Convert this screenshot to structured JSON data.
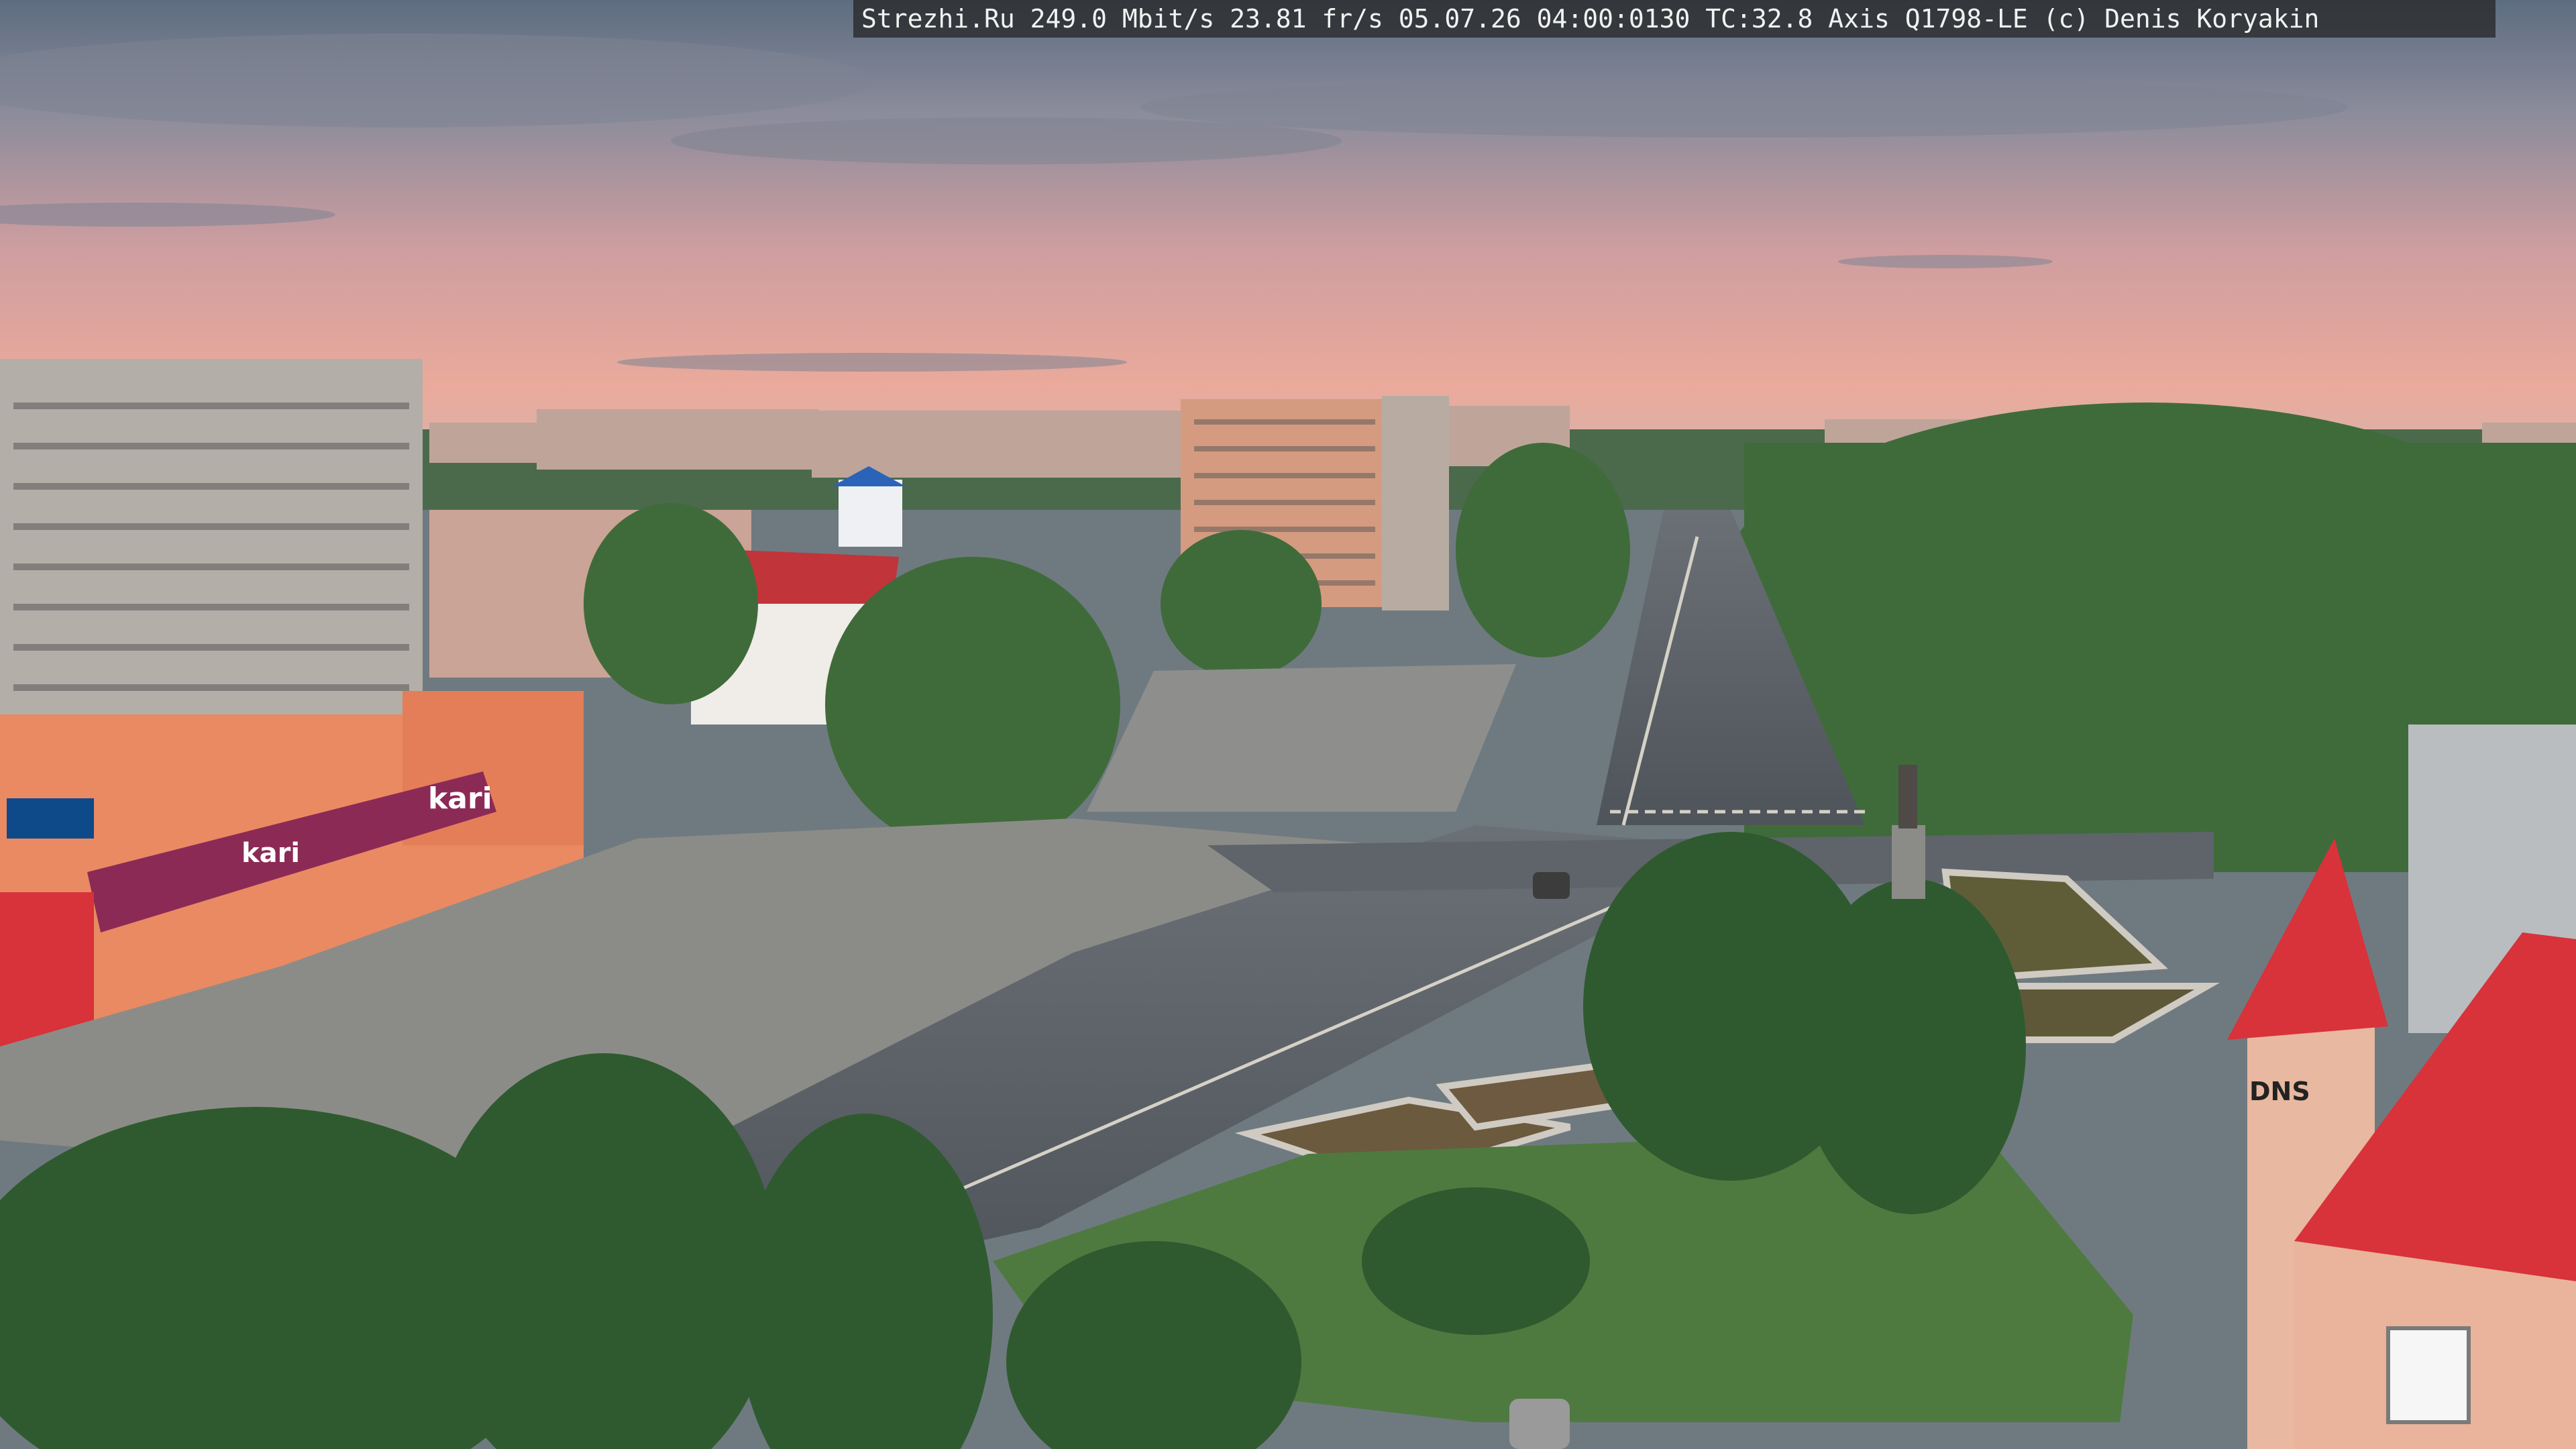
{
  "overlay": {
    "text": "Strezhi.Ru 249.0 Mbit/s 23.81 fr/s 05.07.26 04:00:0130 TC:32.8  Axis Q1798-LE  (c) Denis Koryakin"
  },
  "signs": {
    "store_main": "kari",
    "store_secondary": "kari",
    "tower_shop": "DNS"
  },
  "colors": {
    "sky_top": "#6f8296",
    "sky_mid": "#c99a9c",
    "sky_horizon": "#e9aa9a",
    "tree_green": "#3f6b3a",
    "road": "#5b6167",
    "roof_red": "#d8323a",
    "facade_orange": "#e98a63",
    "store_banner": "#8c2a56"
  }
}
